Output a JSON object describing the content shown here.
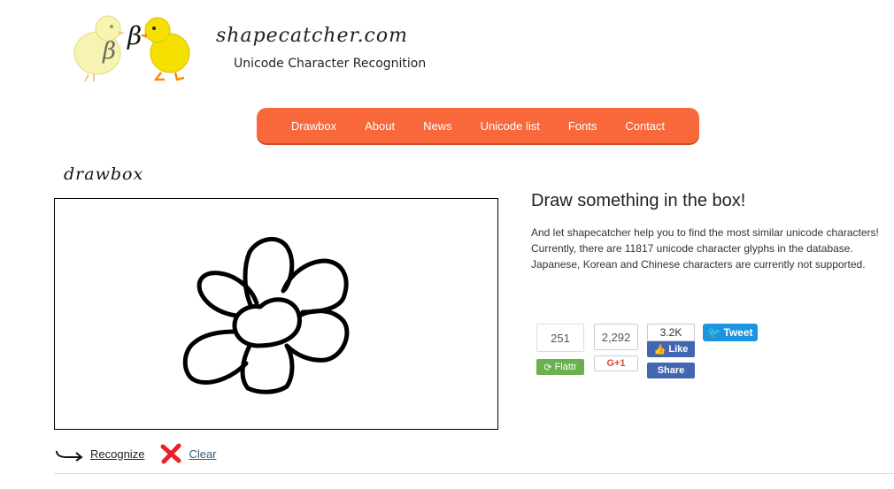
{
  "header": {
    "site_title": "shapecatcher.com",
    "subtitle": "Unicode Character Recognition",
    "logo_glyph": "β"
  },
  "nav": {
    "items": [
      {
        "label": "Drawbox"
      },
      {
        "label": "About"
      },
      {
        "label": "News"
      },
      {
        "label": "Unicode list"
      },
      {
        "label": "Fonts"
      },
      {
        "label": "Contact"
      }
    ]
  },
  "drawbox": {
    "title": "drawbox",
    "recognize_label": "Recognize",
    "clear_label": "Clear"
  },
  "info": {
    "headline": "Draw something in the box!",
    "line1": "And let shapecatcher help you to find the most similar unicode characters!",
    "line2_prefix": "Currently, there are ",
    "glyph_count": "11817",
    "line2_suffix": " unicode character glyphs in the database.",
    "line3": "Japanese, Korean and Chinese characters are currently not supported."
  },
  "social": {
    "flattr_count": "251",
    "flattr_label": "Flattr",
    "gplus_count": "2,292",
    "gplus_label": "G+1",
    "fb_count": "3.2K",
    "fb_like_label": "Like",
    "fb_share_label": "Share",
    "tweet_label": "Tweet"
  },
  "colors": {
    "nav_bg": "#f8683b",
    "flattr_green": "#6ab04c",
    "facebook_blue": "#4267b2",
    "twitter_blue": "#1b95e0",
    "clear_red": "#e8202a"
  }
}
